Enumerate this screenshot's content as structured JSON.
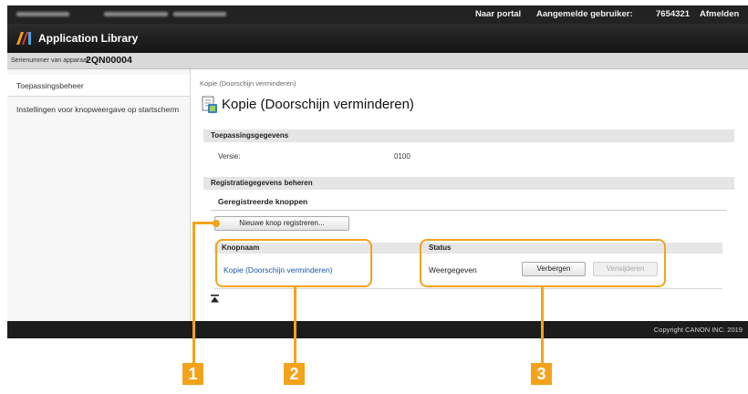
{
  "topbar": {
    "portal_link": "Naar portal",
    "logged_in_label": "Aangemelde gebruiker:",
    "user_id": "7654321",
    "logout_link": "Afmelden"
  },
  "app": {
    "title": "Application Library"
  },
  "serial": {
    "label": "Serienummer van apparaat",
    "value": "2QN00004"
  },
  "sidebar": {
    "items": [
      {
        "label": "Toepassingsbeheer"
      },
      {
        "label": "Instellingen voor knopweergave op startscherm"
      }
    ]
  },
  "main": {
    "breadcrumb": "Kopie (Doorschijn verminderen)",
    "title": "Kopie (Doorschijn verminderen)",
    "app_info": {
      "heading": "Toepassingsgegevens",
      "version_label": "Versie:",
      "version_value": "0100"
    },
    "registration": {
      "heading": "Registratiegegevens beheren",
      "subheading": "Geregistreerde knoppen",
      "new_button": "Nieuwe knop registreren...",
      "columns": {
        "button_name": "Knopnaam",
        "status": "Status"
      },
      "rows": [
        {
          "button_name": "Kopie (Doorschijn verminderen)",
          "status": "Weergegeven",
          "hide_button": "Verbergen",
          "delete_button": "Verwijderen"
        }
      ]
    }
  },
  "footer": {
    "copyright": "Copyright CANON INC. 2019"
  },
  "callouts": [
    "1",
    "2",
    "3"
  ],
  "colors": {
    "callout": "#f3a31b",
    "link": "#1d57a8",
    "topbar": "#222222"
  },
  "icons": {
    "logo": "app-library-logo",
    "title": "copy-app-icon",
    "top": "back-to-top-icon"
  }
}
